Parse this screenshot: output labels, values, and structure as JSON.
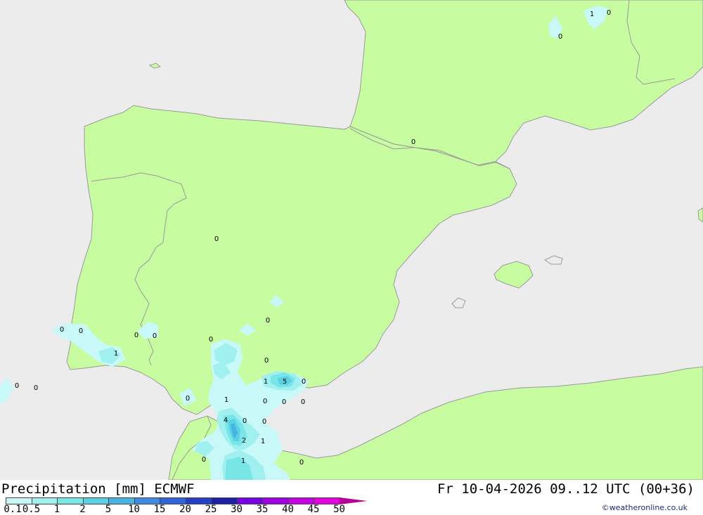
{
  "header": {
    "title": "Precipitation [mm] ECMWF",
    "timestamp": "Fr 10-04-2026 09..12 UTC (00+36)",
    "credit": "©weatheronline.co.uk"
  },
  "legend": {
    "labels": [
      "0.1",
      "0.5",
      "1",
      "2",
      "5",
      "10",
      "15",
      "20",
      "25",
      "30",
      "35",
      "40",
      "45",
      "50"
    ],
    "colors": [
      "#c8f8f8",
      "#a0f0f0",
      "#78e6e6",
      "#5ad2e6",
      "#48b4e6",
      "#3c8ce6",
      "#3064dc",
      "#2440c8",
      "#1a20a8",
      "#7800e6",
      "#a000e6",
      "#c800e6",
      "#e600e6",
      "#b40096"
    ]
  },
  "map": {
    "colors": {
      "sea": "#ececec",
      "land": "#c8fca0",
      "border": "#9a9a9a"
    },
    "values": [
      {
        "id": "v1",
        "text": "1"
      },
      {
        "id": "v2",
        "text": "0"
      },
      {
        "id": "v3",
        "text": "0"
      },
      {
        "id": "v4",
        "text": "0"
      },
      {
        "id": "v5",
        "text": "0"
      },
      {
        "id": "v6",
        "text": "0"
      },
      {
        "id": "v7",
        "text": "0"
      },
      {
        "id": "v8",
        "text": "0"
      },
      {
        "id": "v9",
        "text": "0"
      },
      {
        "id": "v10",
        "text": "1"
      },
      {
        "id": "v11",
        "text": "0"
      },
      {
        "id": "v12",
        "text": "0"
      },
      {
        "id": "v13",
        "text": "0"
      },
      {
        "id": "v14",
        "text": "0"
      },
      {
        "id": "v15",
        "text": "1"
      },
      {
        "id": "v16",
        "text": "5"
      },
      {
        "id": "v17",
        "text": "0"
      },
      {
        "id": "v18",
        "text": "0"
      },
      {
        "id": "v19",
        "text": "1"
      },
      {
        "id": "v20",
        "text": "0"
      },
      {
        "id": "v21",
        "text": "0"
      },
      {
        "id": "v22",
        "text": "0"
      },
      {
        "id": "v23",
        "text": "4"
      },
      {
        "id": "v24",
        "text": "0"
      },
      {
        "id": "v25",
        "text": "0"
      },
      {
        "id": "v26",
        "text": "2"
      },
      {
        "id": "v27",
        "text": "1"
      },
      {
        "id": "v28",
        "text": "0"
      },
      {
        "id": "v29",
        "text": "1"
      },
      {
        "id": "v30",
        "text": "0"
      },
      {
        "id": "v31",
        "text": "0"
      }
    ]
  }
}
